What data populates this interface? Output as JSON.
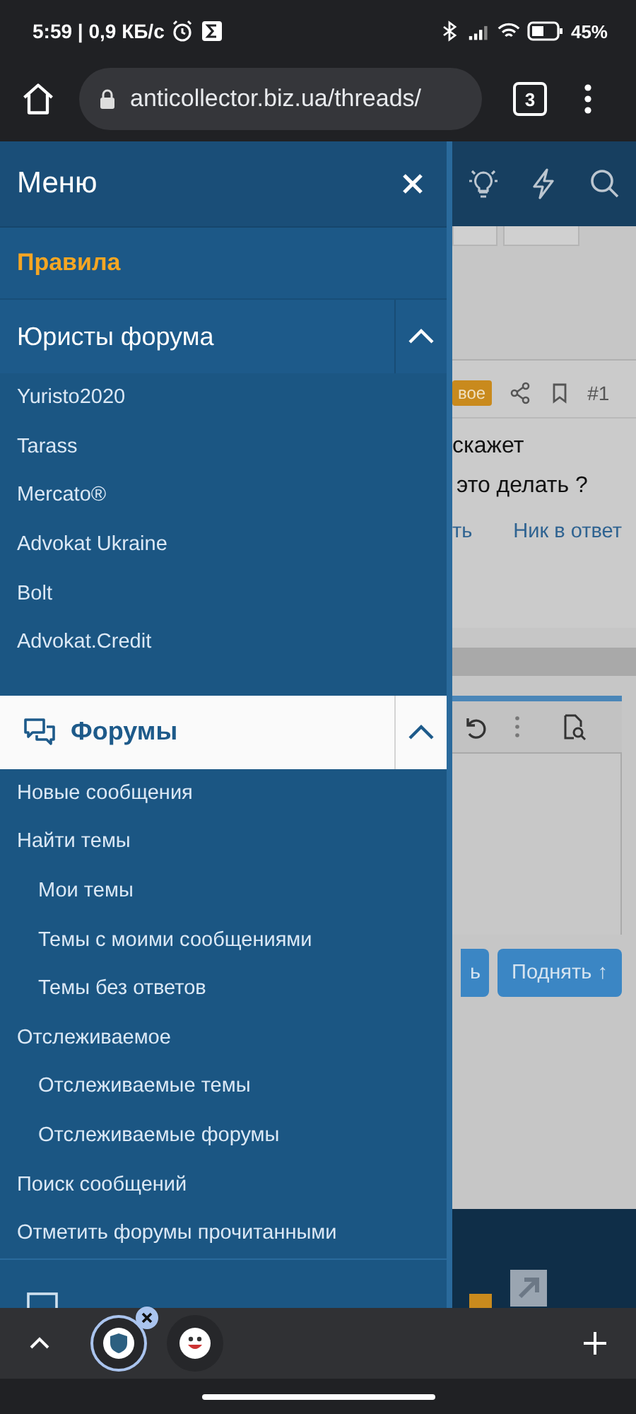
{
  "status_bar": {
    "time": "5:59 | 0,9 КБ/с",
    "battery": "45%"
  },
  "browser": {
    "url": "anticollector.biz.ua/threads/",
    "tab_count": "3"
  },
  "menu": {
    "title": "Меню",
    "sections": [
      {
        "kind": "link",
        "label": "Правила"
      },
      {
        "kind": "group",
        "label": "Юристы форума",
        "icon": false,
        "selected": false,
        "expanded": true,
        "items": [
          {
            "label": "Yuristo2020"
          },
          {
            "label": "Tarass"
          },
          {
            "label": "Mercato®"
          },
          {
            "label": "Advokat Ukraine"
          },
          {
            "label": "Bolt"
          },
          {
            "label": "Advokat.Credit"
          }
        ]
      },
      {
        "kind": "group",
        "label": "Форумы",
        "icon": true,
        "selected": true,
        "expanded": true,
        "items": [
          {
            "label": "Новые сообщения"
          },
          {
            "label": "Найти темы",
            "children": [
              {
                "label": "Мои темы"
              },
              {
                "label": "Темы с моими сообщениями"
              },
              {
                "label": "Темы без ответов"
              }
            ]
          },
          {
            "label": "Отслеживаемое",
            "children": [
              {
                "label": "Отслеживаемые темы"
              },
              {
                "label": "Отслеживаемые форумы"
              }
            ]
          },
          {
            "label": "Поиск сообщений"
          },
          {
            "label": "Отметить форумы прочитанными"
          }
        ]
      }
    ]
  },
  "background_page": {
    "badge": "вое",
    "post_number": "#1",
    "text_lines": [
      "скажет",
      "это делать ?"
    ],
    "links": [
      "ть",
      "Ник в ответ"
    ],
    "buttons": [
      "ь",
      "Поднять ↑"
    ]
  },
  "tab_strip": {
    "tabs": [
      {
        "selected": true
      },
      {
        "selected": false
      }
    ]
  }
}
